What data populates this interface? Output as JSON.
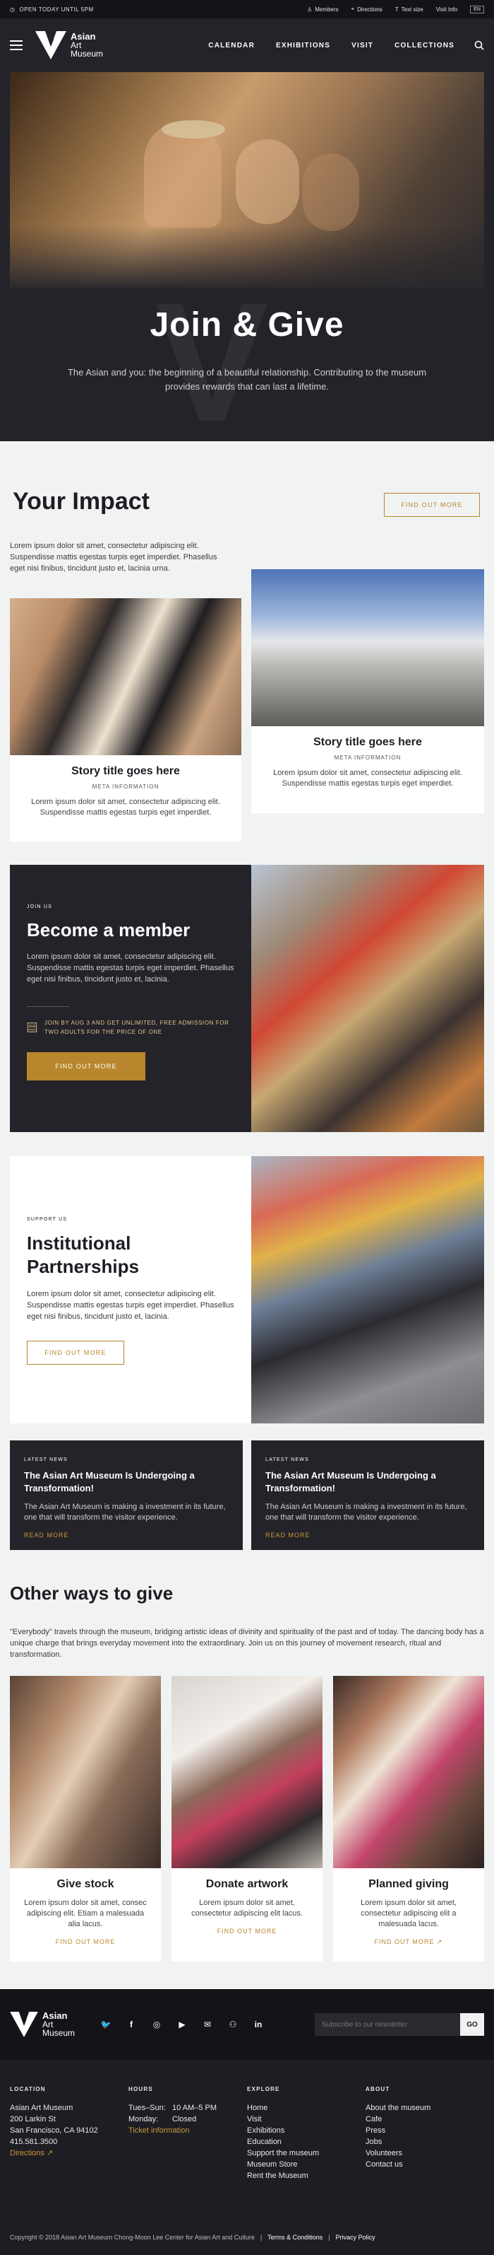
{
  "utility": {
    "open": "OPEN TODAY UNTIL 5PM",
    "links": [
      "Members",
      "Directions",
      "Text size",
      "Visit Info"
    ],
    "lang": "EN"
  },
  "header": {
    "logo_line1": "Asian",
    "logo_line2": "Art",
    "logo_line3": "Museum",
    "nav": [
      "CALENDAR",
      "EXHIBITIONS",
      "VISIT",
      "COLLECTIONS"
    ]
  },
  "hero": {
    "title": "Join & Give",
    "subtitle_line1": "The Asian and you: the beginning of a beautiful relationship. Contributing to the museum",
    "subtitle_line2": "provides rewards that can last a lifetime."
  },
  "impact": {
    "title": "Your Impact",
    "button": "FIND OUT MORE",
    "text": "Lorem ipsum dolor sit amet, consectetur adipiscing elit. Suspendisse mattis egestas turpis eget imperdiet. Phasellus eget nisi finibus, tincidunt justo et, lacinia urna.",
    "cards": [
      {
        "title": "Story title goes here",
        "meta": "META INFORMATION",
        "text": "Lorem ipsum dolor sit amet, consectetur adipiscing elit. Suspendisse mattis egestas turpis eget imperdiet."
      },
      {
        "title": "Story title goes here",
        "meta": "META INFORMATION",
        "text": "Lorem ipsum dolor sit amet, consectetur adipiscing elit. Suspendisse mattis egestas turpis eget imperdiet."
      }
    ]
  },
  "member": {
    "eyebrow": "JOIN US",
    "title": "Become a member",
    "text": "Lorem ipsum dolor sit amet, consectetur adipiscing elit. Suspendisse mattis egestas turpis eget imperdiet. Phasellus eget nisi finibus, tincidunt justo et, lacinia.",
    "perk": "JOIN BY AUG 3 AND GET UNLIMITED, FREE ADMISSION FOR TWO ADULTS FOR THE PRICE OF ONE",
    "button": "FIND OUT MORE"
  },
  "partner": {
    "eyebrow": "SUPPORT US",
    "title_line1": "Institutional",
    "title_line2": "Partnerships",
    "text": "Lorem ipsum dolor sit amet, consectetur adipiscing elit. Suspendisse mattis egestas turpis eget imperdiet. Phasellus eget nisi finibus, tincidunt justo et, lacinia.",
    "button": "FIND OUT MORE"
  },
  "news": [
    {
      "eyebrow": "LATEST NEWS",
      "title": "The Asian Art Museum Is Undergoing a Transformation!",
      "text": "The Asian Art Museum is making a  investment in its future, one that will transform the visitor experience.",
      "link": "READ MORE"
    },
    {
      "eyebrow": "LATEST NEWS",
      "title": "The Asian Art Museum Is Undergoing a Transformation!",
      "text": "The Asian Art Museum is making a  investment in its future, one that will transform the visitor experience.",
      "link": "READ MORE"
    }
  ],
  "other": {
    "title": "Other ways to give",
    "text": "\"Everybody\" travels through the museum, bridging artistic ideas of divinity and spirituality of the past and of today. The dancing body has a unique charge that brings everyday movement into the extraordinary. Join us on this journey of movement research, ritual and transformation.",
    "cards": [
      {
        "title": "Give stock",
        "text": "Lorem ipsum dolor sit amet, consec adipiscing elit. Etiam a malesuada alia lacus.",
        "link": "FIND OUT MORE"
      },
      {
        "title": "Donate artwork",
        "text": "Lorem ipsum dolor sit amet, consectetur adipiscing elit lacus.",
        "link": "FIND OUT MORE"
      },
      {
        "title": "Planned giving",
        "text": "Lorem ipsum dolor sit amet, consectetur adipiscing elit a malesuada lacus.",
        "link": "FIND OUT MORE"
      }
    ]
  },
  "footer": {
    "newsletter_placeholder": "Subscribe to our newsletter",
    "newsletter_button": "GO",
    "location": {
      "heading": "LOCATION",
      "lines": [
        "Asian Art Museum",
        "200 Larkin St",
        "San Francisco, CA 94102",
        "415.581.3500"
      ],
      "directions": "Directions"
    },
    "hours": {
      "heading": "HOURS",
      "days1": "Tues–Sun:",
      "time1": "10 AM–5 PM",
      "days2": "Monday:",
      "time2": "Closed",
      "link": "Ticket information"
    },
    "explore": {
      "heading": "EXPLORE",
      "items": [
        "Home",
        "Visit",
        "Exhibitions",
        "Education",
        "Support the museum",
        "Museum Store",
        "Rent the Museum"
      ]
    },
    "about": {
      "heading": "ABOUT",
      "items": [
        "About the museum",
        "Cafe",
        "Press",
        "Jobs",
        "Volunteers",
        "Contact us"
      ]
    },
    "copyright": "Copyright © 2018 Asian Art Museum Chong-Moon Lee Center for Asian Art and Culture",
    "terms": "Terms & Conditions",
    "privacy": "Privacy Policy"
  }
}
